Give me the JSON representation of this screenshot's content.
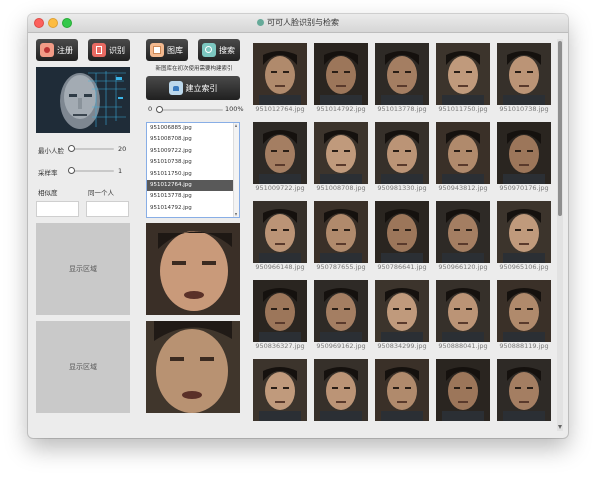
{
  "window": {
    "title": "可可人脸识别与检索"
  },
  "left": {
    "register_label": "注册",
    "recognize_label": "识别",
    "min_face_label": "最小人脸",
    "min_face_value": "20",
    "min_face_level": 0,
    "sample_rate_label": "采样率",
    "sample_rate_value": "1",
    "sample_rate_level": 0,
    "similarity_label": "相似度",
    "same_person_label": "同一个人",
    "similarity_value": "",
    "same_person_value": "",
    "display_area_1": "显示区域",
    "display_area_2": "显示区域"
  },
  "middle": {
    "gallery_label": "图库",
    "search_label": "搜索",
    "hint": "新图库在初次使用需要构建索引",
    "build_index_label": "建立索引",
    "progress_min": "0",
    "progress_max": "100%",
    "progress_value": 0,
    "file_list": [
      {
        "name": "951006885.jpg",
        "selected": false
      },
      {
        "name": "951008708.jpg",
        "selected": false
      },
      {
        "name": "951009722.jpg",
        "selected": false
      },
      {
        "name": "951010738.jpg",
        "selected": false
      },
      {
        "name": "951011750.jpg",
        "selected": false
      },
      {
        "name": "951012764.jpg",
        "selected": true
      },
      {
        "name": "951013778.jpg",
        "selected": false
      },
      {
        "name": "951014792.jpg",
        "selected": false
      }
    ]
  },
  "results": [
    {
      "file": "951012764.jpg"
    },
    {
      "file": "951014792.jpg"
    },
    {
      "file": "951013778.jpg"
    },
    {
      "file": "951011750.jpg"
    },
    {
      "file": "951010738.jpg"
    },
    {
      "file": "951009722.jpg"
    },
    {
      "file": "951008708.jpg"
    },
    {
      "file": "950981330.jpg"
    },
    {
      "file": "950943812.jpg"
    },
    {
      "file": "950970176.jpg"
    },
    {
      "file": "950966148.jpg"
    },
    {
      "file": "950787655.jpg"
    },
    {
      "file": "950786641.jpg"
    },
    {
      "file": "950966120.jpg"
    },
    {
      "file": "950965106.jpg"
    },
    {
      "file": "950836327.jpg"
    },
    {
      "file": "950969162.jpg"
    },
    {
      "file": "950834299.jpg"
    },
    {
      "file": "950888041.jpg"
    },
    {
      "file": "950888119.jpg"
    },
    {
      "file": ""
    },
    {
      "file": ""
    },
    {
      "file": ""
    },
    {
      "file": ""
    },
    {
      "file": ""
    }
  ],
  "colors": {
    "button_bg": "#2b2b2b",
    "selected_row": "#595959",
    "display_area": "#c9c9c9",
    "window_bg": "#ececec"
  }
}
